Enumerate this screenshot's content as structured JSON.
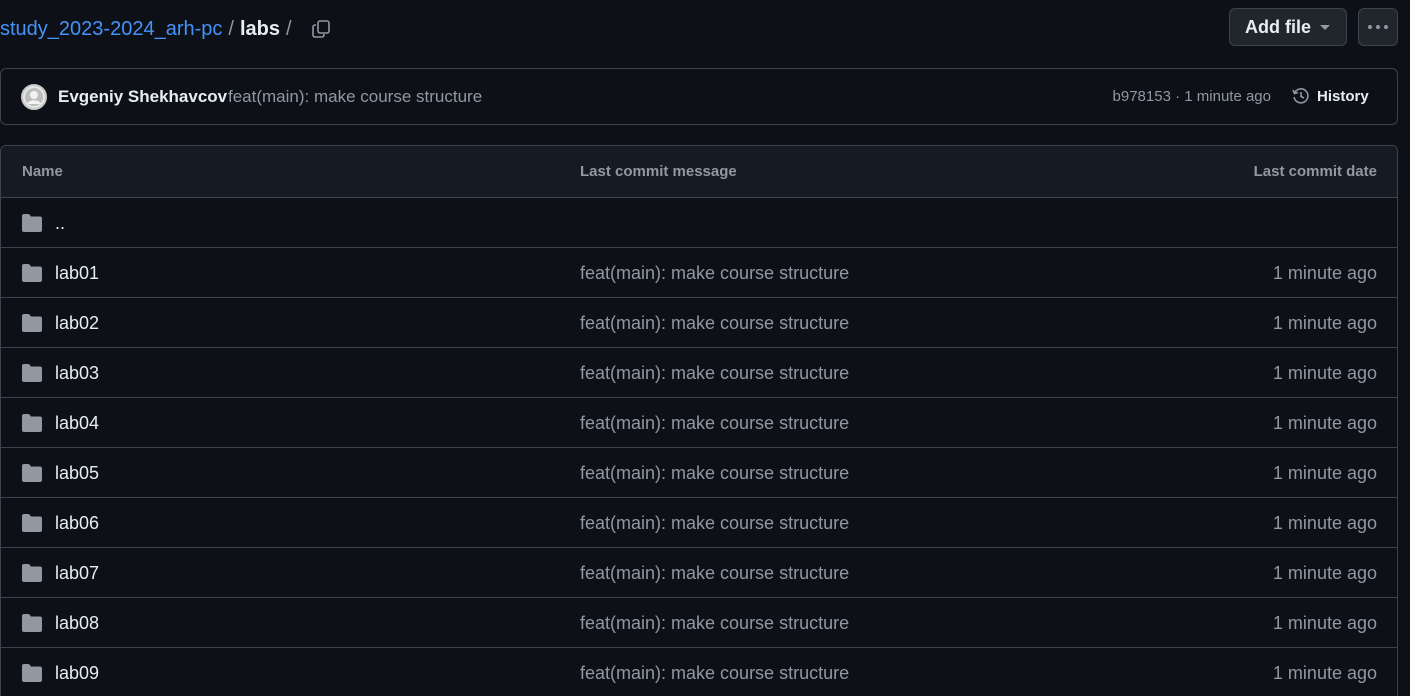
{
  "breadcrumb": {
    "repo": "study_2023-2024_arh-pc",
    "separator": "/",
    "current": "labs",
    "trailing_separator": "/"
  },
  "actions": {
    "add_file_label": "Add file",
    "more_icon": "kebab-horizontal-icon",
    "copy_icon": "copy-icon"
  },
  "latest_commit": {
    "author": "Evgeniy Shekhavcov",
    "message": "feat(main): make course structure",
    "sha": "b978153",
    "dot": "·",
    "time": "1 minute ago",
    "history_label": "History"
  },
  "table": {
    "headers": {
      "name": "Name",
      "message": "Last commit message",
      "date": "Last commit date"
    },
    "parent_dir": "..",
    "rows": [
      {
        "name": "lab01",
        "message": "feat(main): make course structure",
        "date": "1 minute ago"
      },
      {
        "name": "lab02",
        "message": "feat(main): make course structure",
        "date": "1 minute ago"
      },
      {
        "name": "lab03",
        "message": "feat(main): make course structure",
        "date": "1 minute ago"
      },
      {
        "name": "lab04",
        "message": "feat(main): make course structure",
        "date": "1 minute ago"
      },
      {
        "name": "lab05",
        "message": "feat(main): make course structure",
        "date": "1 minute ago"
      },
      {
        "name": "lab06",
        "message": "feat(main): make course structure",
        "date": "1 minute ago"
      },
      {
        "name": "lab07",
        "message": "feat(main): make course structure",
        "date": "1 minute ago"
      },
      {
        "name": "lab08",
        "message": "feat(main): make course structure",
        "date": "1 minute ago"
      },
      {
        "name": "lab09",
        "message": "feat(main): make course structure",
        "date": "1 minute ago"
      }
    ]
  },
  "colors": {
    "background": "#0d1117",
    "link": "#4493f8",
    "muted": "#9198a1",
    "border": "#3d444d",
    "folder": "#9198a1"
  }
}
